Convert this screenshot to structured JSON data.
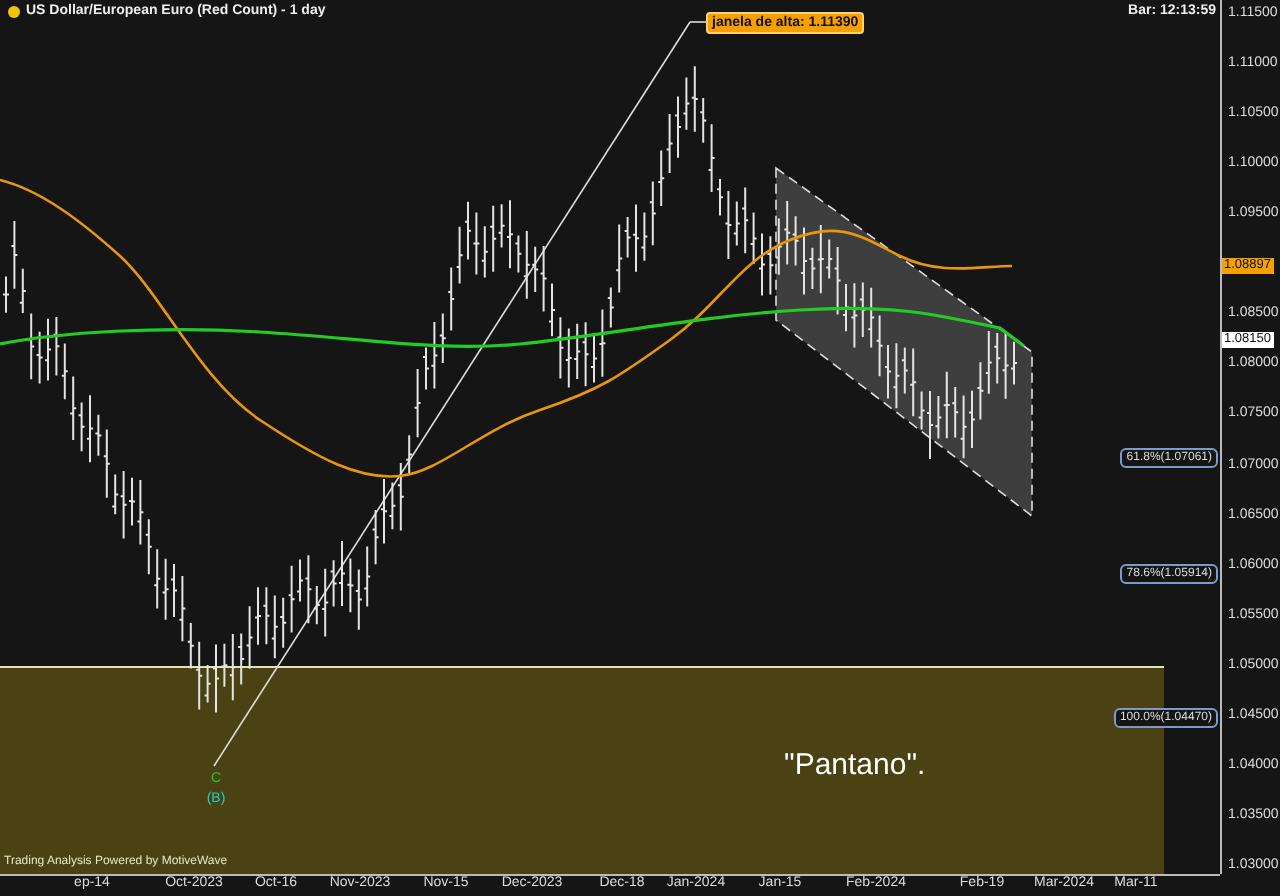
{
  "chart": {
    "title": "US Dollar/European Euro (Red Count) - 1 day",
    "bar_time": "Bar: 12:13:59",
    "callout": "janela de alta: 1.11390",
    "wave_labels": [
      {
        "text": "C",
        "color": "#22cc22"
      },
      {
        "text": "(B)",
        "color": "#22cccc"
      }
    ],
    "fib_labels": [
      "61.8%(1.07061)",
      "78.6%(1.05914)",
      "100.0%(1.04470)"
    ],
    "zone_label": "\"Pantano\".",
    "credit": "Trading Analysis Powered by MotiveWave"
  },
  "price_axis": {
    "ticks": [
      "1.11500",
      "1.11000",
      "1.10500",
      "1.10000",
      "1.09500",
      "1.08500",
      "1.08000",
      "1.07500",
      "1.07000",
      "1.06500",
      "1.06000",
      "1.05500",
      "1.05000",
      "1.04500",
      "1.04000",
      "1.03500",
      "1.03000"
    ],
    "tags": [
      {
        "value": "1.08897",
        "color": "#f5a000"
      },
      {
        "value": "1.08150",
        "color": "#ffffff"
      }
    ]
  },
  "date_axis": {
    "labels": [
      "ep-14",
      "Oct-2023",
      "Oct-16",
      "Nov-2023",
      "Nov-15",
      "Dec-2023",
      "Dec-18",
      "Jan-2024",
      "Jan-15",
      "Feb-2024",
      "Feb-19",
      "Mar-2024",
      "Mar-11"
    ]
  }
}
